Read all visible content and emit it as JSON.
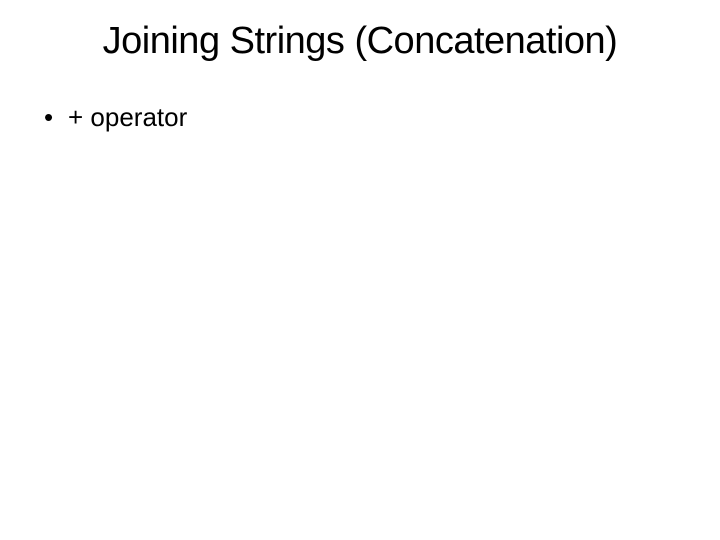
{
  "slide": {
    "title": "Joining Strings (Concatenation)",
    "bullets": [
      {
        "text": "+ operator"
      }
    ]
  }
}
